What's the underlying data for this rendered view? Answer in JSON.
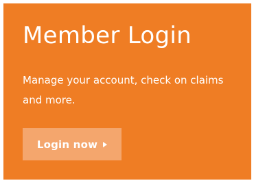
{
  "card": {
    "title": "Member Login",
    "description": "Manage your account, check on claims and more.",
    "button": {
      "label": "Login now",
      "icon": "play-triangle-icon"
    }
  },
  "colors": {
    "card_background": "#ef7d24",
    "button_background": "#f4a66d",
    "text": "#ffffff"
  }
}
